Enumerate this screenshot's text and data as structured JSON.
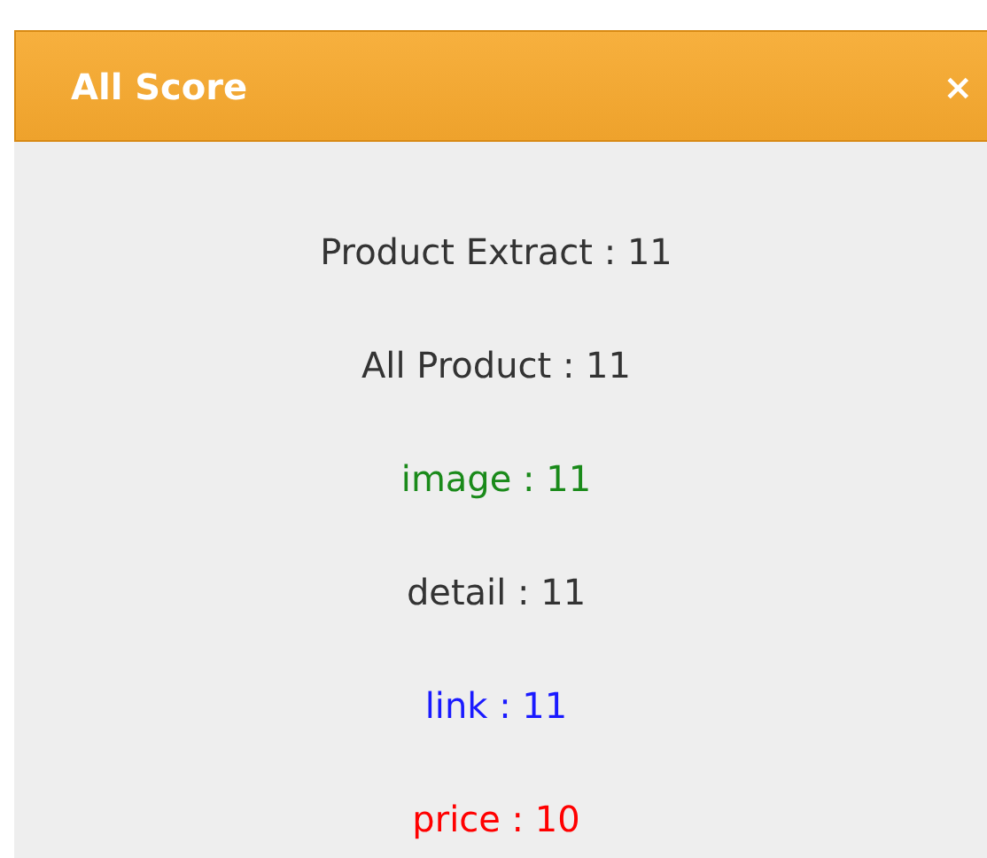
{
  "dialog": {
    "title": "All Score",
    "close": "×"
  },
  "scores": [
    {
      "text": "Product Extract : 11",
      "color": "#333333"
    },
    {
      "text": "All Product : 11",
      "color": "#333333"
    },
    {
      "text": "image : 11",
      "color": "#1a8a1a"
    },
    {
      "text": "detail : 11",
      "color": "#333333"
    },
    {
      "text": "link : 11",
      "color": "#1a1aff"
    },
    {
      "text": "price : 10",
      "color": "#ff0000"
    }
  ]
}
